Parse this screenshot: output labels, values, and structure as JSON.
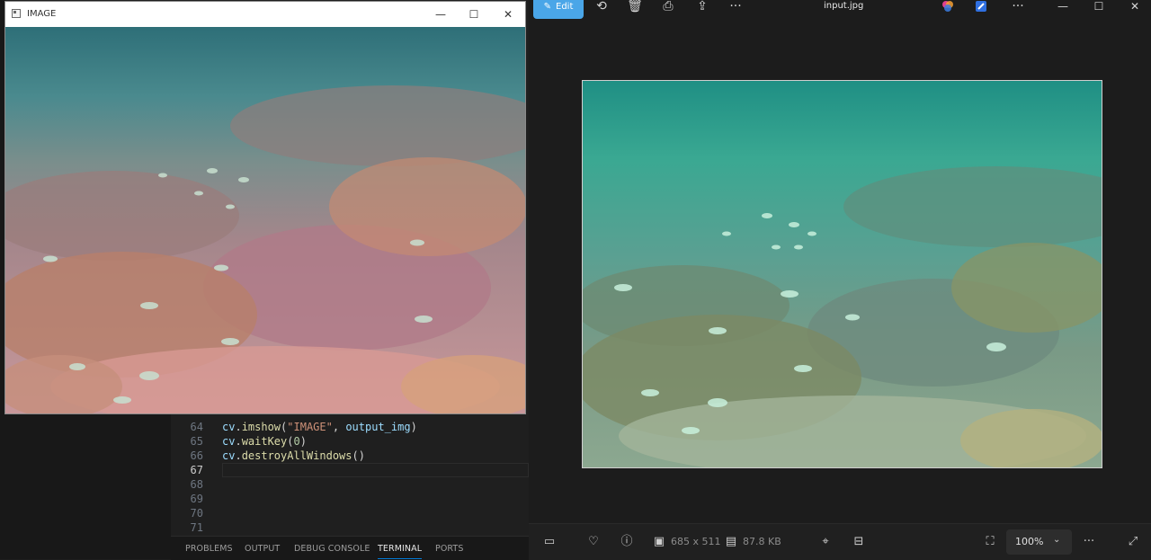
{
  "opencv_window": {
    "title": "IMAGE",
    "controls": {
      "minimize": "—",
      "maximize": "☐",
      "close": "✕"
    }
  },
  "editor": {
    "lines": [
      {
        "number": "64",
        "tokens": [
          [
            "obj",
            "cv"
          ],
          [
            "pn",
            "."
          ],
          [
            "fn",
            "imshow"
          ],
          [
            "pn",
            "("
          ],
          [
            "str",
            "\"IMAGE\""
          ],
          [
            "pn",
            ", "
          ],
          [
            "obj",
            "output_img"
          ],
          [
            "pn",
            ")"
          ]
        ]
      },
      {
        "number": "65",
        "tokens": [
          [
            "obj",
            "cv"
          ],
          [
            "pn",
            "."
          ],
          [
            "fn",
            "waitKey"
          ],
          [
            "pn",
            "("
          ],
          [
            "num",
            "0"
          ],
          [
            "pn",
            ")"
          ]
        ]
      },
      {
        "number": "66",
        "tokens": [
          [
            "obj",
            "cv"
          ],
          [
            "pn",
            "."
          ],
          [
            "fn",
            "destroyAllWindows"
          ],
          [
            "pn",
            "()"
          ]
        ]
      },
      {
        "number": "67",
        "tokens": []
      },
      {
        "number": "68",
        "tokens": []
      },
      {
        "number": "69",
        "tokens": []
      },
      {
        "number": "70",
        "tokens": []
      },
      {
        "number": "71",
        "tokens": []
      }
    ],
    "active_line": "67"
  },
  "panel_tabs": [
    "PROBLEMS",
    "OUTPUT",
    "DEBUG CONSOLE",
    "TERMINAL",
    "PORTS"
  ],
  "panel_active_tab": "TERMINAL",
  "photos": {
    "edit_label": "Edit",
    "filename": "input.jpg",
    "toolbar_icons": [
      "rotate-icon",
      "delete-icon",
      "print-icon",
      "share-icon",
      "more-icon"
    ],
    "dimensions": "685 x 511",
    "file_size": "87.8 KB",
    "zoom": "100%"
  },
  "colors": {
    "vscode_bg": "#1f1f1f",
    "photos_bg": "#1c1c1c",
    "accent": "#4aa6e8",
    "terminal_underline": "#0078d4"
  }
}
